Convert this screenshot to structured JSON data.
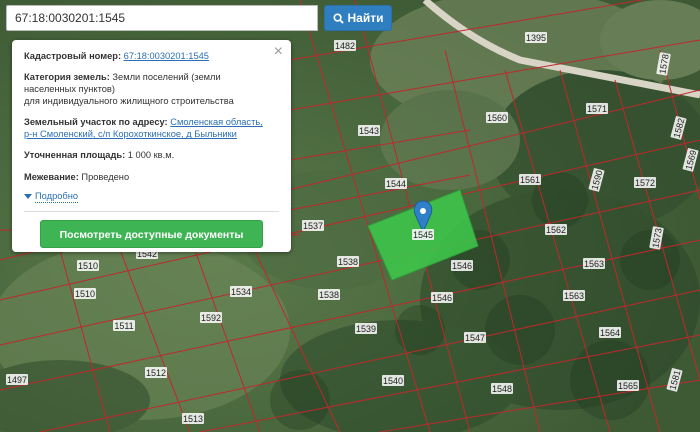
{
  "search": {
    "value": "67:18:0030201:1545",
    "button_label": "Найти",
    "button_icon": "search-icon"
  },
  "popup": {
    "cadastral_label": "Кадастровый номер:",
    "cadastral_value": "67:18:0030201:1545",
    "category_label": "Категория земель:",
    "category_value_1": "Земли поселений (земли",
    "category_value_2": "населенных пунктов)",
    "category_value_3": "для индивидуального жилищного строительства",
    "address_label": "Земельный участок по адресу:",
    "address_value_1": "Смоленская область,",
    "address_value_2": "р-н Смоленский, с/п Корохоткинское, д Быльники",
    "area_label": "Уточненная площадь:",
    "area_value": "1 000 кв.м.",
    "survey_label": "Межевание:",
    "survey_value": "Проведено",
    "more_label": "Подробно",
    "docs_button": "Посмотреть доступные документы",
    "close_icon": "close-icon"
  },
  "map": {
    "selected_parcel_color": "#3ec44a",
    "parcel_border_color": "#c0282d",
    "marker_color": "#2f80c9",
    "labels": [
      {
        "id": "1482",
        "text": "1482"
      },
      {
        "id": "1395",
        "text": "1395"
      },
      {
        "id": "1578",
        "text": "1578"
      },
      {
        "id": "1571",
        "text": "1571"
      },
      {
        "id": "1543",
        "text": "1543"
      },
      {
        "id": "1560",
        "text": "1560"
      },
      {
        "id": "1544",
        "text": "1544"
      },
      {
        "id": "1561",
        "text": "1561"
      },
      {
        "id": "1572",
        "text": "1572"
      },
      {
        "id": "1562",
        "text": "1562"
      },
      {
        "id": "1537",
        "text": "1537"
      },
      {
        "id": "1545",
        "text": "1545"
      },
      {
        "id": "1538a",
        "text": "1538"
      },
      {
        "id": "1546a",
        "text": "1546"
      },
      {
        "id": "1563a",
        "text": "1563"
      },
      {
        "id": "1510a",
        "text": "1510"
      },
      {
        "id": "1542",
        "text": "1542"
      },
      {
        "id": "1510b",
        "text": "1510"
      },
      {
        "id": "1534",
        "text": "1534"
      },
      {
        "id": "1538b",
        "text": "1538"
      },
      {
        "id": "1546b",
        "text": "1546"
      },
      {
        "id": "1563b",
        "text": "1563"
      },
      {
        "id": "1511",
        "text": "1511"
      },
      {
        "id": "1592",
        "text": "1592"
      },
      {
        "id": "1539",
        "text": "1539"
      },
      {
        "id": "1547",
        "text": "1547"
      },
      {
        "id": "1564",
        "text": "1564"
      },
      {
        "id": "1497",
        "text": "1497"
      },
      {
        "id": "1512",
        "text": "1512"
      },
      {
        "id": "1540",
        "text": "1540"
      },
      {
        "id": "1548",
        "text": "1548"
      },
      {
        "id": "1565",
        "text": "1565"
      },
      {
        "id": "1513",
        "text": "1513"
      },
      {
        "id": "1573",
        "text": "1573"
      },
      {
        "id": "1582",
        "text": "1582"
      },
      {
        "id": "1590",
        "text": "1590"
      },
      {
        "id": "1569",
        "text": "1569"
      },
      {
        "id": "1581",
        "text": "1581"
      }
    ]
  }
}
